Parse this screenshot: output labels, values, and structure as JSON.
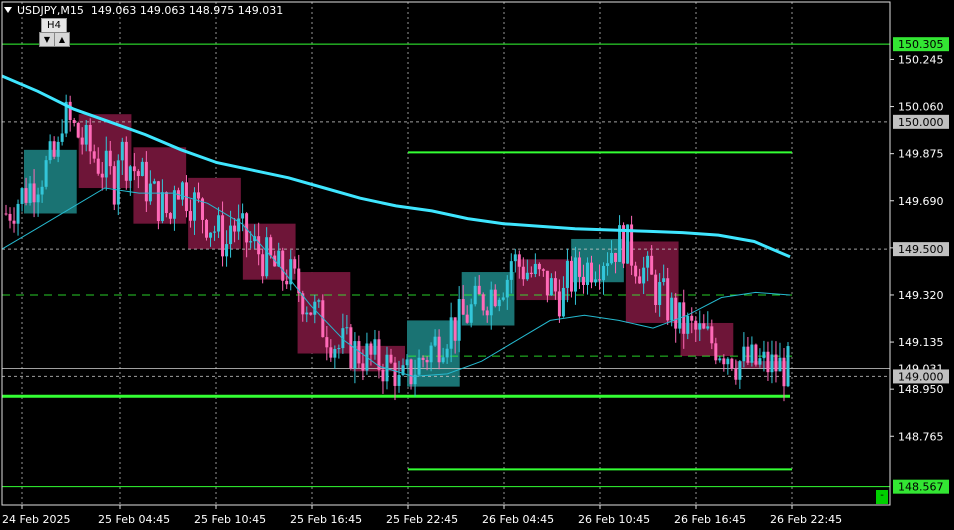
{
  "header": {
    "symbol": "USDJPY,M15",
    "ohlc": "149.063 149.063 148.975 149.031"
  },
  "timeframe_widget": {
    "label": "H4",
    "down_icon": "▼",
    "up_icon": "▲"
  },
  "corner_button": {
    "label": "-"
  },
  "colors": {
    "background": "#000000",
    "bull_candle": "#33c6d9",
    "bear_candle": "#ff6ab8",
    "h4_bull_box": "#1a7373",
    "h4_bear_box": "#6e1538",
    "ma_thick": "#3fe6ff",
    "ma_thin": "#25b9cf",
    "level_green": "#33ff33",
    "grid": "#c8c8c8",
    "price_scale_text": "#ffffff"
  },
  "chart_data": {
    "type": "candlestick",
    "symbol": "USDJPY",
    "timeframe": "M15",
    "ylim": [
      148.55,
      150.4
    ],
    "price_ticks": [
      "150.245",
      "150.060",
      "149.875",
      "149.690",
      "149.505",
      "149.320",
      "149.135",
      "148.950",
      "148.765"
    ],
    "time_ticks": [
      "24 Feb 2025",
      "25 Feb 04:45",
      "25 Feb 10:45",
      "25 Feb 16:45",
      "25 Feb 22:45",
      "26 Feb 04:45",
      "26 Feb 10:45",
      "26 Feb 16:45",
      "26 Feb 22:45"
    ],
    "price_labels": [
      {
        "text": "150.305",
        "value": 150.305,
        "style": "green"
      },
      {
        "text": "150.000",
        "value": 150.0,
        "style": "grey"
      },
      {
        "text": "149.500",
        "value": 149.5,
        "style": "grey"
      },
      {
        "text": "149.031",
        "value": 149.031,
        "style": "plain"
      },
      {
        "text": "149.000",
        "value": 149.0,
        "style": "grey"
      },
      {
        "text": "148.567",
        "value": 148.567,
        "style": "green"
      }
    ],
    "h_levels": [
      {
        "value": 150.305,
        "style": "green-thin"
      },
      {
        "value": 148.567,
        "style": "green-thin"
      },
      {
        "value": 148.922,
        "style": "green-thick"
      },
      {
        "value": 150.0,
        "style": "grey-dotted"
      },
      {
        "value": 149.5,
        "style": "grey-dotted"
      },
      {
        "value": 149.0,
        "style": "grey-dotted"
      },
      {
        "value": 149.031,
        "style": "grey-solid"
      }
    ],
    "range_lines": [
      {
        "value": 149.88,
        "style": "green",
        "from": "25 Feb 22:45",
        "to": "26 Feb 22:45"
      },
      {
        "value": 148.635,
        "style": "green",
        "from": "25 Feb 22:45",
        "to": "26 Feb 22:45"
      },
      {
        "value": 149.32,
        "style": "green-dashed",
        "from": "24 Feb 2025",
        "to": "26 Feb 22:45"
      },
      {
        "value": 149.08,
        "style": "green-dashed",
        "from": "25 Feb 22:45",
        "to": "26 Feb 22:45"
      }
    ],
    "h4_boxes": [
      {
        "open": 149.64,
        "close": 149.89,
        "dir": "bull"
      },
      {
        "open": 150.03,
        "close": 149.74,
        "dir": "bear"
      },
      {
        "open": 149.9,
        "close": 149.6,
        "dir": "bear"
      },
      {
        "open": 149.78,
        "close": 149.5,
        "dir": "bear"
      },
      {
        "open": 149.6,
        "close": 149.38,
        "dir": "bear"
      },
      {
        "open": 149.41,
        "close": 149.09,
        "dir": "bear"
      },
      {
        "open": 149.12,
        "close": 149.02,
        "dir": "bear"
      },
      {
        "open": 148.96,
        "close": 149.22,
        "dir": "bull"
      },
      {
        "open": 149.2,
        "close": 149.41,
        "dir": "bull"
      },
      {
        "open": 149.46,
        "close": 149.3,
        "dir": "bear"
      },
      {
        "open": 149.37,
        "close": 149.54,
        "dir": "bull"
      },
      {
        "open": 149.53,
        "close": 149.21,
        "dir": "bear"
      },
      {
        "open": 149.21,
        "close": 149.08,
        "dir": "bear"
      },
      {
        "open": 149.06,
        "close": 149.03,
        "dir": "bear"
      }
    ],
    "ma_slow": [
      150.18,
      150.12,
      150.05,
      150.0,
      149.95,
      149.89,
      149.84,
      149.81,
      149.78,
      149.74,
      149.7,
      149.67,
      149.65,
      149.62,
      149.6,
      149.59,
      149.58,
      149.575,
      149.57,
      149.565,
      149.555,
      149.53,
      149.47
    ],
    "ma_fast": [
      149.5,
      149.58,
      149.66,
      149.74,
      149.72,
      149.72,
      149.68,
      149.6,
      149.45,
      149.28,
      149.14,
      149.04,
      149.0,
      149.01,
      149.06,
      149.14,
      149.22,
      149.24,
      149.22,
      149.19,
      149.24,
      149.31,
      149.33,
      149.32
    ]
  }
}
